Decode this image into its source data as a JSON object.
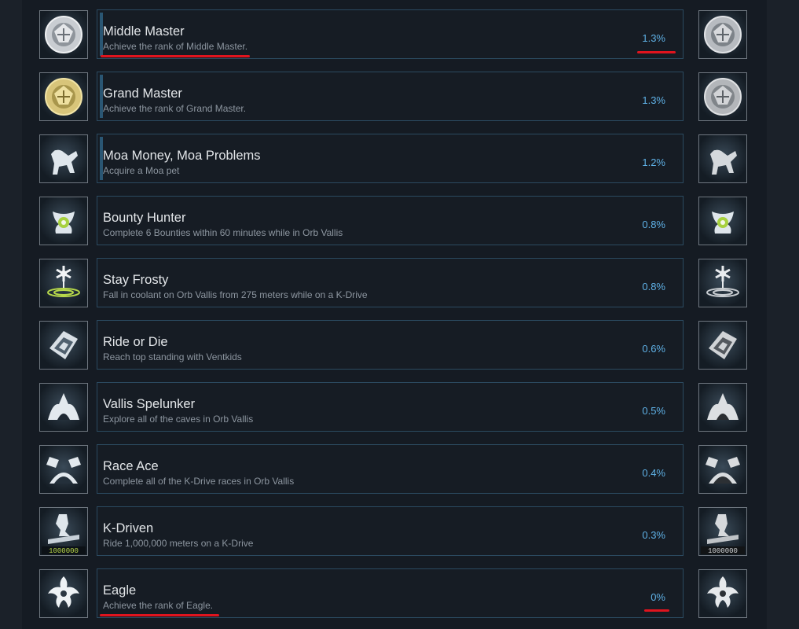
{
  "achievements": [
    {
      "title": "Middle Master",
      "desc": "Achieve the rank of Middle Master.",
      "percent": "1.3%",
      "icon": "middle-master-badge-icon",
      "accent": true,
      "icon_tint": "silver",
      "highlighted": true
    },
    {
      "title": "Grand Master",
      "desc": "Achieve the rank of Grand Master.",
      "percent": "1.3%",
      "icon": "grand-master-badge-icon",
      "accent": true,
      "icon_tint": "gold"
    },
    {
      "title": "Moa Money, Moa Problems",
      "desc": "Acquire a Moa pet",
      "percent": "1.2%",
      "icon": "moa-pet-icon",
      "accent": true
    },
    {
      "title": "Bounty Hunter",
      "desc": "Complete 6 Bounties within 60 minutes while in Orb Vallis",
      "percent": "0.8%",
      "icon": "bounty-hunter-icon",
      "icon_tint": "green"
    },
    {
      "title": "Stay Frosty",
      "desc": "Fall in coolant on Orb Vallis from 275 meters while on a K-Drive",
      "percent": "0.8%",
      "icon": "coolant-splash-icon",
      "icon_tint": "green"
    },
    {
      "title": "Ride or Die",
      "desc": "Reach top standing with Ventkids",
      "percent": "0.6%",
      "icon": "ventkids-board-icon"
    },
    {
      "title": "Vallis Spelunker",
      "desc": "Explore all of the caves in Orb Vallis",
      "percent": "0.5%",
      "icon": "cave-icon"
    },
    {
      "title": "Race Ace",
      "desc": "Complete all of the K-Drive races in Orb Vallis",
      "percent": "0.4%",
      "icon": "race-flags-icon"
    },
    {
      "title": "K-Driven",
      "desc": "Ride 1,000,000 meters on a K-Drive",
      "percent": "0.3%",
      "icon": "k-drive-rider-icon",
      "badge_text": "1000000"
    },
    {
      "title": "Eagle",
      "desc": "Achieve the rank of Eagle.",
      "percent": "0%",
      "icon": "warframe-eagle-icon",
      "highlighted": true
    }
  ],
  "colors": {
    "panel": "#151b23",
    "card_border": "#2b4a60",
    "percent": "#5fb1e6",
    "annotation": "#e0141e"
  }
}
